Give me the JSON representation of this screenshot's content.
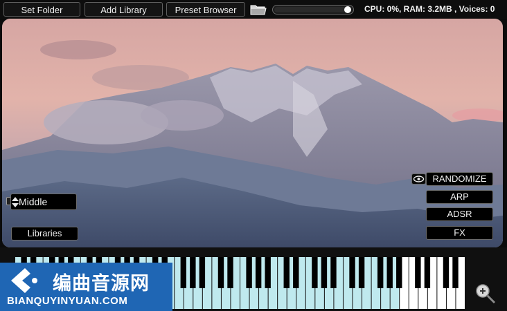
{
  "toolbar": {
    "set_folder_label": "Set Folder",
    "add_library_label": "Add Library",
    "preset_browser_label": "Preset Browser",
    "folder_icon": "folder-icon",
    "volume_level": 0.93,
    "status_text": "CPU: 0%, RAM: 3.2MB , Voices: 0"
  },
  "panel": {
    "background": "mountain landscape with pink sky",
    "articulation_selected": "Middle",
    "libraries_label": "Libraries",
    "randomize_label": "RANDOMIZE",
    "arp_label": "ARP",
    "adsr_label": "ADSR",
    "fx_label": "FX"
  },
  "keyboard": {
    "white_key_color": "#bfe9ee",
    "inactive_white_key_color": "#ffffff",
    "black_key_color": "#000000"
  },
  "watermark": {
    "cn_text": "编曲音源网",
    "en_text": "BIANQUYINYUAN.COM",
    "color": "#1f66b4"
  },
  "colors": {
    "button_bg": "#141414",
    "button_border": "#5f5f5f",
    "text": "#f0f0f0"
  }
}
